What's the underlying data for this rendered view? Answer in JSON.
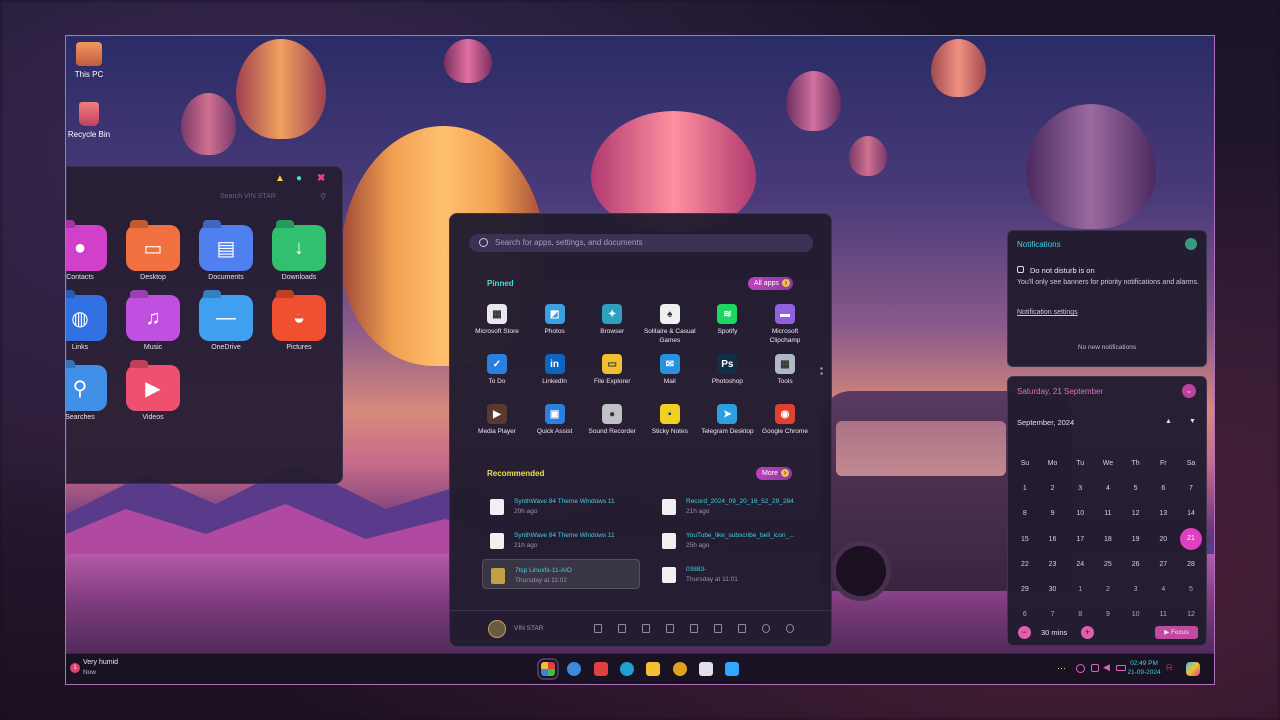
{
  "desktop": {
    "icons": [
      {
        "label": "This PC"
      },
      {
        "label": "Recycle Bin"
      }
    ]
  },
  "explorer": {
    "search_placeholder": "Search VIN STAR",
    "folders": [
      {
        "label": "Contacts",
        "color": "#d040c8",
        "glyph": "●"
      },
      {
        "label": "Desktop",
        "color": "#f07040",
        "glyph": "▭"
      },
      {
        "label": "Documents",
        "color": "#5080f0",
        "glyph": "▤"
      },
      {
        "label": "Downloads",
        "color": "#30c070",
        "glyph": "↓"
      },
      {
        "label": "Links",
        "color": "#3070e0",
        "glyph": "◍"
      },
      {
        "label": "Music",
        "color": "#c050e0",
        "glyph": "♫"
      },
      {
        "label": "OneDrive",
        "color": "#40a0f0",
        "glyph": "—"
      },
      {
        "label": "Pictures",
        "color": "#f05030",
        "glyph": "◒"
      },
      {
        "label": "Searches",
        "color": "#4090e8",
        "glyph": "⚲"
      },
      {
        "label": "Videos",
        "color": "#f05070",
        "glyph": "▶"
      }
    ]
  },
  "start_menu": {
    "search_placeholder": "Search for apps, settings, and documents",
    "pinned_title": "Pinned",
    "all_apps_label": "All apps",
    "pinned": [
      {
        "label": "Microsoft Store",
        "color": "#e8e8f0",
        "glyph": "▦"
      },
      {
        "label": "Photos",
        "color": "#3aa0e0",
        "glyph": "◩"
      },
      {
        "label": "Browser",
        "color": "#30a0c0",
        "glyph": "✦"
      },
      {
        "label": "Solitaire & Casual Games",
        "color": "#f0f0f0",
        "glyph": "♠"
      },
      {
        "label": "Spotify",
        "color": "#1ed760",
        "glyph": "≋"
      },
      {
        "label": "Microsoft Clipchamp",
        "color": "#9060e0",
        "glyph": "▬"
      },
      {
        "label": "To Do",
        "color": "#2a80e0",
        "glyph": "✓"
      },
      {
        "label": "LinkedIn",
        "color": "#0a66c2",
        "glyph": "in"
      },
      {
        "label": "File Explorer",
        "color": "#f0c030",
        "glyph": "▭"
      },
      {
        "label": "Mail",
        "color": "#2a90e0",
        "glyph": "✉"
      },
      {
        "label": "Photoshop",
        "color": "#10304a",
        "glyph": "Ps"
      },
      {
        "label": "Tools",
        "color": "#b0b8c8",
        "glyph": "▦"
      },
      {
        "label": "Media Player",
        "color": "#5a3a30",
        "glyph": "▶"
      },
      {
        "label": "Quick Assist",
        "color": "#2a80e0",
        "glyph": "▣"
      },
      {
        "label": "Sound Recorder",
        "color": "#c0c0c8",
        "glyph": "●"
      },
      {
        "label": "Sticky Notes",
        "color": "#f0d020",
        "glyph": "▪"
      },
      {
        "label": "Telegram Desktop",
        "color": "#2aa0e0",
        "glyph": "➤"
      },
      {
        "label": "Google Chrome",
        "color": "#e04030",
        "glyph": "◉"
      }
    ],
    "recommended_title": "Recommended",
    "more_label": "More",
    "recommended": [
      {
        "title": "SynthWave 84 Theme Windows 11",
        "sub": "20h ago"
      },
      {
        "title": "Record_2024_09_20_16_52_29_284",
        "sub": "21h ago"
      },
      {
        "title": "SynthWave 84 Theme Windows 11",
        "sub": "21h ago"
      },
      {
        "title": "YouTube_like_subscribe_bell_icon_...",
        "sub": "25h ago"
      },
      {
        "title": "7tsp Linuxfx-11-AIO",
        "sub": "Thursday at 11:02"
      },
      {
        "title": "03883-",
        "sub": "Thursday at 11:01"
      }
    ],
    "user_name": "VIN STAR"
  },
  "notifications": {
    "title": "Notifications",
    "dnd_title": "Do not disturb is on",
    "dnd_body": "You'll only see banners for priority notifications and alarms.",
    "settings_link": "Notification settings",
    "empty": "No new notifications"
  },
  "calendar": {
    "date_header": "Saturday, 21 September",
    "month_label": "September, 2024",
    "weekdays": [
      "Su",
      "Mo",
      "Tu",
      "We",
      "Th",
      "Fr",
      "Sa"
    ],
    "weeks": [
      [
        "1",
        "2",
        "3",
        "4",
        "5",
        "6",
        "7"
      ],
      [
        "8",
        "9",
        "10",
        "11",
        "12",
        "13",
        "14"
      ],
      [
        "15",
        "16",
        "17",
        "18",
        "19",
        "20",
        "21"
      ],
      [
        "22",
        "23",
        "24",
        "25",
        "26",
        "27",
        "28"
      ],
      [
        "29",
        "30",
        "1",
        "2",
        "3",
        "4",
        "5"
      ],
      [
        "6",
        "7",
        "8",
        "9",
        "10",
        "11",
        "12"
      ]
    ],
    "today": "21",
    "focus_minutes": "30 mins",
    "focus_label": "Focus"
  },
  "taskbar": {
    "weather_title": "Very humid",
    "weather_sub": "Now",
    "time": "02:49 PM",
    "date": "21-09-2024",
    "apps": [
      {
        "name": "start",
        "color": "#c04050"
      },
      {
        "name": "search",
        "color": "#3a8ae0"
      },
      {
        "name": "task-view",
        "color": "#e04040"
      },
      {
        "name": "edge",
        "color": "#20a0d0"
      },
      {
        "name": "file-explorer",
        "color": "#f0c030"
      },
      {
        "name": "chrome",
        "color": "#e0a020"
      },
      {
        "name": "store",
        "color": "#e0e0e8"
      },
      {
        "name": "photoshop",
        "color": "#31a8ff"
      }
    ]
  }
}
